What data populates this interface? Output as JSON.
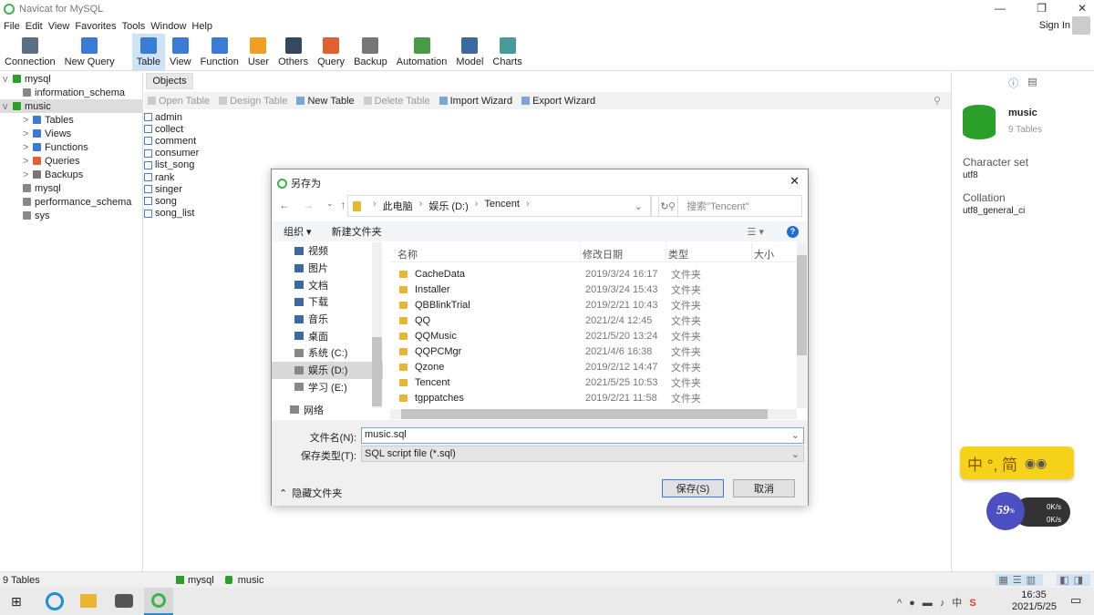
{
  "window": {
    "title": "Navicat for MySQL",
    "sign_in": "Sign In"
  },
  "menu": [
    "File",
    "Edit",
    "View",
    "Favorites",
    "Tools",
    "Window",
    "Help"
  ],
  "toolbar": [
    {
      "label": "Connection",
      "color": "#5a6e86"
    },
    {
      "label": "New Query",
      "color": "#3a7bd5"
    },
    {
      "label": "Table",
      "color": "#3a7bd5",
      "active": true
    },
    {
      "label": "View",
      "color": "#3a7bd5"
    },
    {
      "label": "Function",
      "color": "#3a7bd5"
    },
    {
      "label": "User",
      "color": "#f0a020"
    },
    {
      "label": "Others",
      "color": "#34495e"
    },
    {
      "label": "Query",
      "color": "#e06030"
    },
    {
      "label": "Backup",
      "color": "#777777"
    },
    {
      "label": "Automation",
      "color": "#4a9a4a"
    },
    {
      "label": "Model",
      "color": "#3a6aa0"
    },
    {
      "label": "Charts",
      "color": "#4a9a9a"
    }
  ],
  "tree": [
    {
      "label": "mysql",
      "level": 0,
      "arrow": "v",
      "color": "#2aa02a"
    },
    {
      "label": "information_schema",
      "level": 1,
      "color": "#888888"
    },
    {
      "label": "music",
      "level": 0,
      "arrow": "v",
      "color": "#2aa02a",
      "selected": true
    },
    {
      "label": "Tables",
      "level": 2,
      "arrow": ">",
      "color": "#3a7bd5"
    },
    {
      "label": "Views",
      "level": 2,
      "arrow": ">",
      "color": "#3a7bd5"
    },
    {
      "label": "Functions",
      "level": 2,
      "arrow": ">",
      "color": "#3a7bd5"
    },
    {
      "label": "Queries",
      "level": 2,
      "arrow": ">",
      "color": "#e06030"
    },
    {
      "label": "Backups",
      "level": 2,
      "arrow": ">",
      "color": "#777777"
    },
    {
      "label": "mysql",
      "level": 1,
      "color": "#888888"
    },
    {
      "label": "performance_schema",
      "level": 1,
      "color": "#888888"
    },
    {
      "label": "sys",
      "level": 1,
      "color": "#888888"
    }
  ],
  "objects": {
    "tab": "Objects",
    "actions": [
      {
        "label": "Open Table",
        "enabled": false
      },
      {
        "label": "Design Table",
        "enabled": false
      },
      {
        "label": "New Table",
        "enabled": true
      },
      {
        "label": "Delete Table",
        "enabled": false
      },
      {
        "label": "Import Wizard",
        "enabled": true
      },
      {
        "label": "Export Wizard",
        "enabled": true
      }
    ],
    "tables": [
      "admin",
      "collect",
      "comment",
      "consumer",
      "list_song",
      "rank",
      "singer",
      "song",
      "song_list"
    ]
  },
  "info": {
    "name": "music",
    "sub": "9 Tables",
    "charset_label": "Character set",
    "charset": "utf8",
    "collation_label": "Collation",
    "collation": "utf8_general_ci"
  },
  "dialog": {
    "title": "另存为",
    "path": [
      "此电脑",
      "娱乐 (D:)",
      "Tencent"
    ],
    "search_placeholder": "搜索\"Tencent\"",
    "organize": "组织 ▾",
    "new_folder": "新建文件夹",
    "nav": [
      "视频",
      "图片",
      "文档",
      "下载",
      "音乐",
      "桌面",
      "系统 (C:)",
      "娱乐 (D:)",
      "学习 (E:)",
      "网络"
    ],
    "nav_selected": "娱乐 (D:)",
    "columns": [
      "名称",
      "修改日期",
      "类型",
      "大小"
    ],
    "files": [
      {
        "name": "CacheData",
        "date": "2019/3/24 16:17",
        "type": "文件夹"
      },
      {
        "name": "Installer",
        "date": "2019/3/24 15:43",
        "type": "文件夹"
      },
      {
        "name": "QBBlinkTrial",
        "date": "2019/2/21 10:43",
        "type": "文件夹"
      },
      {
        "name": "QQ",
        "date": "2021/2/4 12:45",
        "type": "文件夹"
      },
      {
        "name": "QQMusic",
        "date": "2021/5/20 13:24",
        "type": "文件夹"
      },
      {
        "name": "QQPCMgr",
        "date": "2021/4/6 16:38",
        "type": "文件夹"
      },
      {
        "name": "Qzone",
        "date": "2019/2/12 14:47",
        "type": "文件夹"
      },
      {
        "name": "Tencent",
        "date": "2021/5/25 10:53",
        "type": "文件夹"
      },
      {
        "name": "tgppatches",
        "date": "2019/2/21 11:58",
        "type": "文件夹"
      }
    ],
    "filename_label": "文件名(N):",
    "filename": "music.sql",
    "filetype_label": "保存类型(T):",
    "filetype": "SQL script file (*.sql)",
    "hide_folders": "隐藏文件夹",
    "save": "保存(S)",
    "cancel": "取消"
  },
  "ime": {
    "text": "中 °, 简",
    "speed_percent": "59",
    "up": "0K/s",
    "down": "0K/s"
  },
  "status": {
    "count": "9 Tables",
    "conn": "mysql",
    "db": "music"
  },
  "taskbar": {
    "time": "16:35",
    "date": "2021/5/25"
  }
}
